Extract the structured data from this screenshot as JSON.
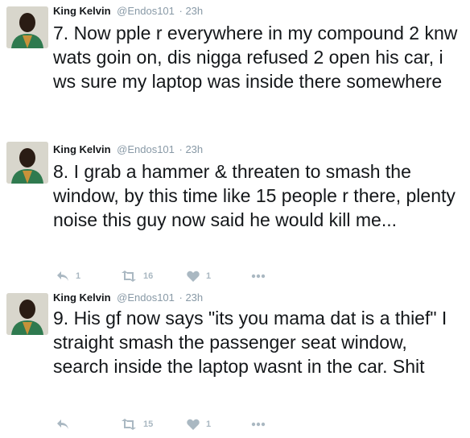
{
  "colors": {
    "text": "#14171a",
    "secondary": "#8899a6",
    "action_icon": "#aab8c2"
  },
  "tweets": [
    {
      "author": "King Kelvin",
      "handle": "@Endos101",
      "time": "· 23h",
      "text": "7. Now pple r everywhere in my compound 2 knw wats goin on, dis nigga refused 2 open his car, i ws sure my laptop was inside there somewhere",
      "actions": null
    },
    {
      "author": "King Kelvin",
      "handle": "@Endos101",
      "time": "· 23h",
      "text": "8. I grab a hammer & threaten to smash the window, by this time like 15 people r there, plenty noise this guy now said he would kill me...",
      "actions": {
        "reply_icon": "reply-icon",
        "reply_count": "1",
        "retweet_icon": "retweet-icon",
        "retweet_count": "16",
        "like_icon": "heart-icon",
        "like_count": "1",
        "more_icon": "more-icon"
      }
    },
    {
      "author": "King Kelvin",
      "handle": "@Endos101",
      "time": "· 23h",
      "text": "9. His gf now says \"its you mama dat is a thief\" I straight smash the passenger seat window, search inside the laptop wasnt in the car. Shit",
      "actions": {
        "reply_icon": "reply-icon",
        "retweet_icon": "retweet-icon",
        "retweet_count": "15",
        "like_icon": "heart-icon",
        "like_count": "1",
        "more_icon": "more-icon"
      }
    }
  ]
}
